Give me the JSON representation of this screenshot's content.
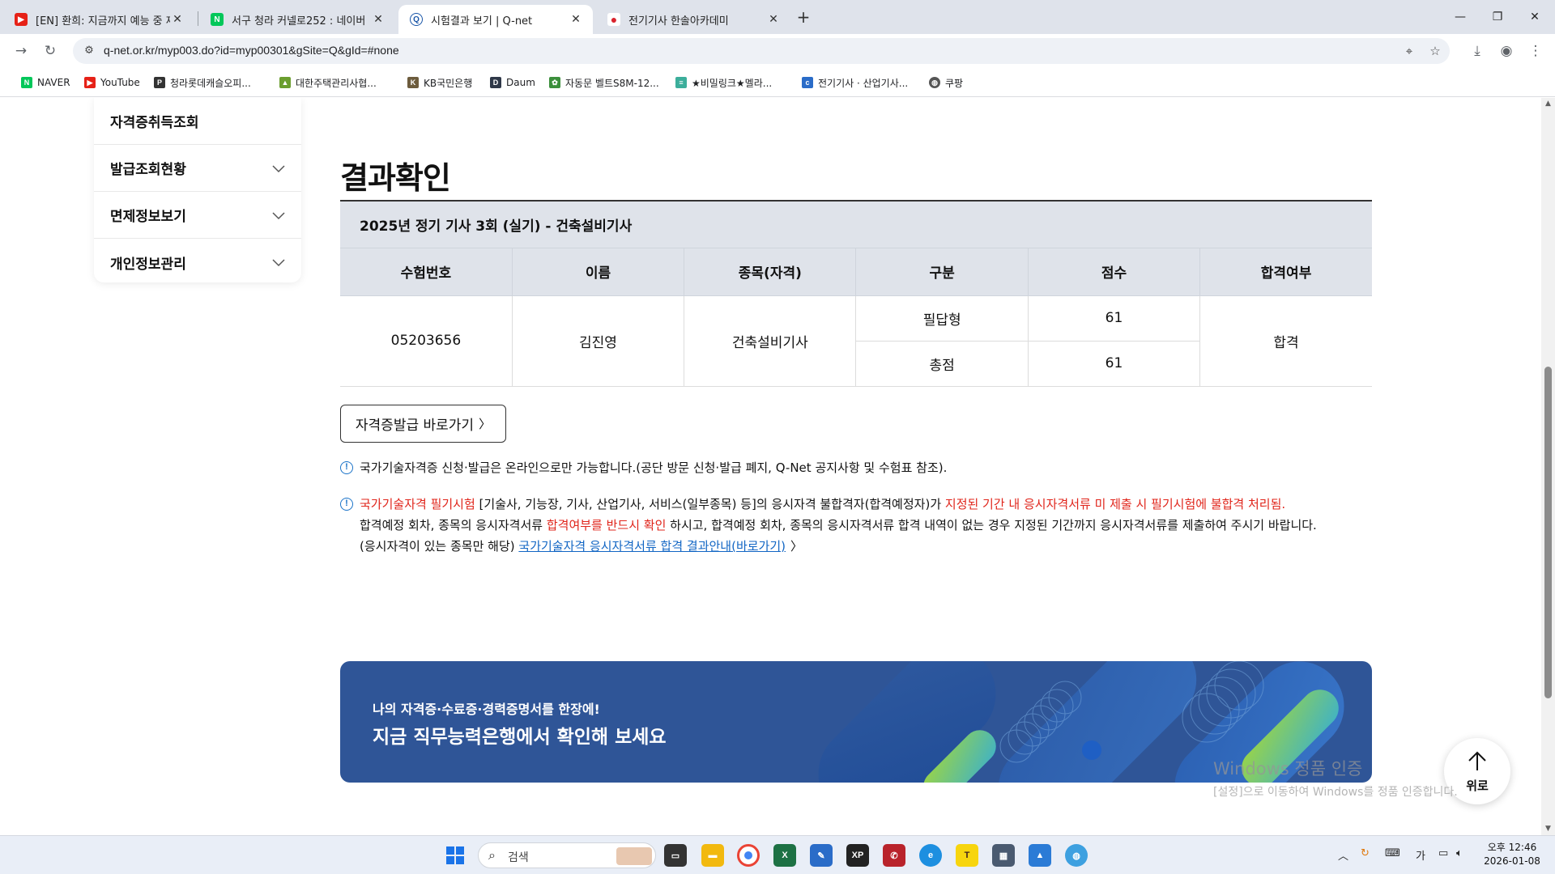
{
  "browser": {
    "tabs": [
      {
        "title": "[EN] 환희: 지금까지 예능 중 제",
        "favicon": "youtube-icon",
        "color": "#e62117"
      },
      {
        "title": "서구 청라 커넬로252 : 네이버",
        "favicon": "naver-icon",
        "color": "#03c75a"
      },
      {
        "title": "시험결과 보기 | Q-net",
        "favicon": "qnet-icon",
        "color": "#1a56a8"
      },
      {
        "title": "전기기사 한솔아카데미",
        "favicon": "hansol-icon",
        "color": "#d9232d"
      }
    ],
    "url": "q-net.or.kr/myp003.do?id=myp00301&gSite=Q&gId=#none",
    "bookmarks": [
      {
        "label": "NAVER",
        "icon": "naver-icon",
        "color": "#03c75a"
      },
      {
        "label": "YouTube",
        "icon": "youtube-icon",
        "color": "#e62117"
      },
      {
        "label": "청라롯데캐슬오피...",
        "icon": "bookmark-icon",
        "color": "#333333"
      },
      {
        "label": "대한주택관리사협...",
        "icon": "association-icon",
        "color": "#6b9e2f"
      },
      {
        "label": "KB국민은행",
        "icon": "kb-icon",
        "color": "#6d5c3d"
      },
      {
        "label": "Daum",
        "icon": "daum-icon",
        "color": "#2f3848"
      },
      {
        "label": "자동문 벨트S8M-12...",
        "icon": "gear-icon",
        "color": "#3c8f3c"
      },
      {
        "label": "★비밀링크★멜라...",
        "icon": "link-icon",
        "color": "#3cae9b"
      },
      {
        "label": "전기기사 · 산업기사...",
        "icon": "cafe-icon",
        "color": "#2a6cc8"
      },
      {
        "label": "쿠팡",
        "icon": "globe-icon",
        "color": "#555555"
      }
    ]
  },
  "sidebar": {
    "items": [
      {
        "label": "자격증취득조회",
        "has_chevron": false
      },
      {
        "label": "발급조회현황",
        "has_chevron": true
      },
      {
        "label": "면제정보보기",
        "has_chevron": true
      },
      {
        "label": "개인정보관리",
        "has_chevron": true
      }
    ]
  },
  "main": {
    "title": "결과확인",
    "exam_title": "2025년 정기 기사 3회 (실기) - 건축설비기사",
    "table": {
      "headers": [
        "수험번호",
        "이름",
        "종목(자격)",
        "구분",
        "점수",
        "합격여부"
      ],
      "exam_number": "05203656",
      "name": "김진영",
      "qualification": "건축설비기사",
      "rows": [
        {
          "category": "필답형",
          "score": "61"
        },
        {
          "category": "총점",
          "score": "61"
        }
      ],
      "result": "합격"
    },
    "issue_button": "자격증발급 바로가기",
    "notice1": "국가기술자격증 신청·발급은 온라인으로만 가능합니다.(공단 방문 신청·발급 폐지, Q-Net 공지사항 및 수험표 참조).",
    "notice2": {
      "part1_red": "국가기술자격 필기시험",
      "part2": " [기술사, 기능장, 기사, 산업기사, 서비스(일부종목) 등]의 응시자격 불합격자(합격예정자)가 ",
      "part3_red": "지정된 기간 내 응시자격서류 미 제출 시 필기시험에 불합격 처리됨.",
      "line2_a": "합격예정 회차, 종목의 응시자격서류 ",
      "line2_red": "합격여부를 반드시 확인",
      "line2_b": " 하시고, 합격예정 회차, 종목의 응시자격서류 합격 내역이 없는 경우 지정된 기간까지 응시자격서류를 제출하여 주시기 바랍니다.",
      "line3_a": "(응시자격이 있는 종목만 해당) ",
      "line3_link": "국가기술자격 응시자격서류 합격 결과안내(바로가기)"
    },
    "banner": {
      "line1": "나의 자격증·수료증·경력증명서를 한장에!",
      "line2": "지금 직무능력은행에서 확인해 보세요"
    },
    "top_button": "위로"
  },
  "watermark": {
    "line1": "Windows 정품 인증",
    "line2": "[설정]으로 이동하여 Windows를 정품 인증합니다."
  },
  "taskbar": {
    "search_label": "검색",
    "ime": "가",
    "time": "오후 12:46",
    "date": "2026-01-08"
  },
  "colors": {
    "accent_red": "#e0251b",
    "link_blue": "#1266c4",
    "banner_bg": "#2f5597",
    "header_bg": "#dfe3ea"
  }
}
